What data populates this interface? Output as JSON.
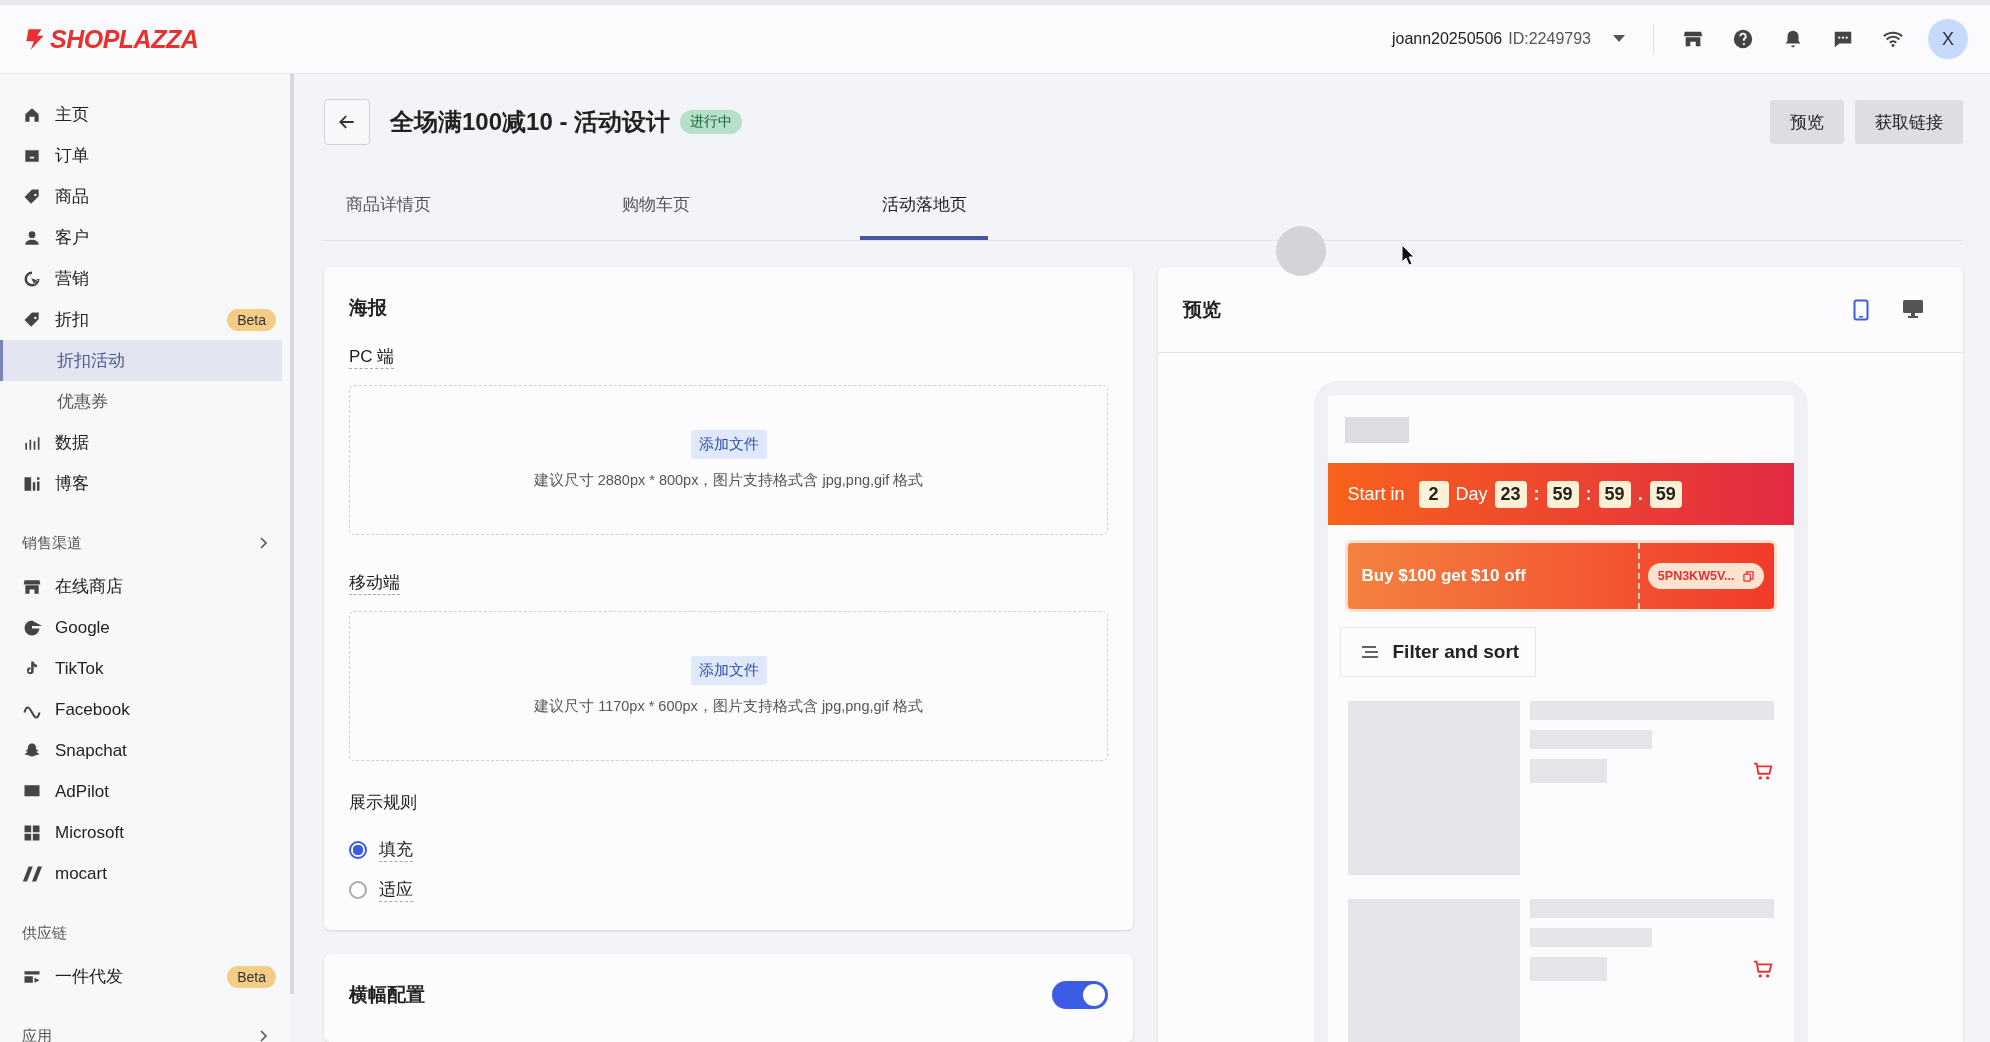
{
  "topbar": {
    "logo": "SHOPLAZZA",
    "account": "joann20250506",
    "account_id": "ID:2249793",
    "avatar": "X"
  },
  "sidebar": {
    "groups": [
      {
        "items": [
          {
            "label": "主页",
            "selected": false
          },
          {
            "label": "订单",
            "selected": false
          },
          {
            "label": "商品",
            "selected": false
          },
          {
            "label": "客户",
            "selected": false
          },
          {
            "label": "营销",
            "selected": false
          },
          {
            "label": "折扣",
            "badge": "Beta",
            "selected": false,
            "expanded": true,
            "children": [
              {
                "label": "折扣活动",
                "selected": true
              },
              {
                "label": "优惠券",
                "selected": false
              }
            ]
          },
          {
            "label": "数据",
            "selected": false
          },
          {
            "label": "博客",
            "selected": false
          }
        ]
      },
      {
        "heading": "销售渠道",
        "chevron": true,
        "items": [
          {
            "label": "在线商店",
            "selected": false
          },
          {
            "label": "Google",
            "selected": false
          },
          {
            "label": "TikTok",
            "selected": false
          },
          {
            "label": "Facebook",
            "selected": false
          },
          {
            "label": "Snapchat",
            "selected": false
          },
          {
            "label": "AdPilot",
            "selected": false
          },
          {
            "label": "Microsoft",
            "selected": false
          },
          {
            "label": "mocart",
            "selected": false
          }
        ]
      },
      {
        "heading": "供应链",
        "chevron": false,
        "items": [
          {
            "label": "一件代发",
            "badge": "Beta",
            "selected": false
          }
        ]
      },
      {
        "heading": "应用",
        "chevron": true
      }
    ]
  },
  "header": {
    "title": "全场满100减10 - 活动设计",
    "status": "进行中",
    "actions": [
      "预览",
      "获取链接"
    ]
  },
  "tabs": [
    {
      "label": "商品详情页",
      "selected": false
    },
    {
      "label": "购物车页",
      "selected": false
    },
    {
      "label": "活动落地页",
      "selected": true
    }
  ],
  "poster": {
    "title": "海报",
    "uploads": [
      {
        "label": "PC 端",
        "button": "添加文件",
        "hint": "建议尺寸 2880px * 800px，图片支持格式含 jpg,png,gif 格式"
      },
      {
        "label": "移动端",
        "button": "添加文件",
        "hint": "建议尺寸 1170px * 600px，图片支持格式含 jpg,png,gif 格式"
      }
    ],
    "rule": {
      "label": "展示规则",
      "options": [
        {
          "label": "填充",
          "selected": true
        },
        {
          "label": "适应",
          "selected": false
        }
      ]
    }
  },
  "banner": {
    "title": "横幅配置",
    "on": true
  },
  "preview": {
    "title": "预览",
    "devices": [
      {
        "kind": "mobile",
        "selected": true
      },
      {
        "kind": "desktop",
        "selected": false
      }
    ],
    "countdown": {
      "label": "Start in",
      "parts": [
        {
          "kind": "box",
          "text": "2"
        },
        {
          "kind": "text",
          "text": "Day"
        },
        {
          "kind": "box",
          "text": "23"
        },
        {
          "kind": "sep",
          "text": ":"
        },
        {
          "kind": "box",
          "text": "59"
        },
        {
          "kind": "sep",
          "text": ":"
        },
        {
          "kind": "box",
          "text": "59"
        },
        {
          "kind": "sep",
          "text": "."
        },
        {
          "kind": "box",
          "text": "59"
        }
      ]
    },
    "coupon": {
      "text": "Buy $100 get $10 off",
      "code": "5PN3KW5V..."
    },
    "filter": "Filter and sort"
  }
}
